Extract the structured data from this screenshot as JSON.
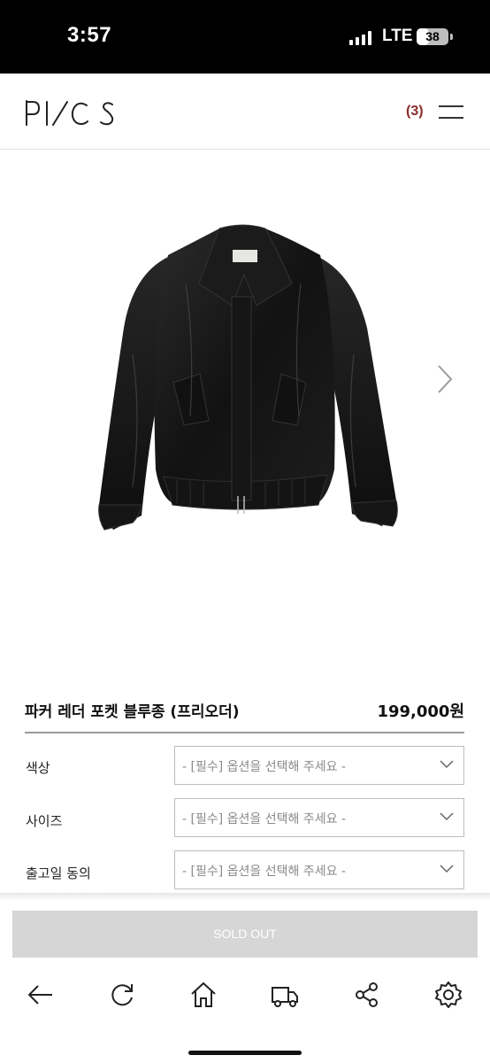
{
  "status_bar": {
    "time": "3:57",
    "network": "LTE",
    "battery": "38",
    "battery_fraction": 0.38
  },
  "header": {
    "logo_text": "PI/CS",
    "cart_count": "(3)"
  },
  "product": {
    "name": "파커 레더 포켓 블루종 (프리오더)",
    "price": "199,000원",
    "image_icon": "leather-jacket-photo",
    "next_icon": "chevron-right-icon"
  },
  "options": [
    {
      "label": "색상",
      "placeholder": "- [필수] 옵션을 선택해 주세요 -"
    },
    {
      "label": "사이즈",
      "placeholder": "- [필수] 옵션을 선택해 주세요 -"
    },
    {
      "label": "출고일 동의",
      "placeholder": "- [필수] 옵션을 선택해 주세요 -"
    }
  ],
  "sold_out_label": "SOLD OUT",
  "toolbar": [
    "back-arrow-icon",
    "reload-icon",
    "home-icon",
    "delivery-truck-icon",
    "share-icon",
    "settings-gear-icon"
  ]
}
